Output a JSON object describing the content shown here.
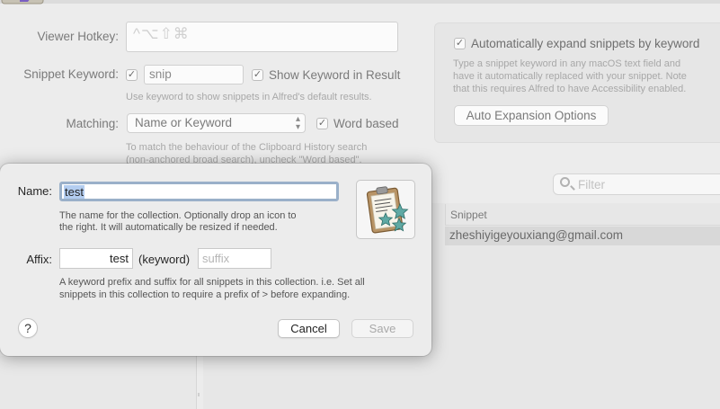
{
  "settings": {
    "viewer_hotkey_label": "Viewer Hotkey:",
    "hotkey_glyphs": "^⌥⇧⌘",
    "snippet_keyword_label": "Snippet Keyword:",
    "snippet_keyword_value": "snip",
    "snippet_keyword_checked": "✓",
    "show_keyword_label": "Show Keyword in Result",
    "show_keyword_checked": "✓",
    "keyword_hint": "Use keyword to show snippets in Alfred's default results.",
    "matching_label": "Matching:",
    "matching_value": "Name or Keyword",
    "word_based_label": "Word based",
    "word_based_checked": "✓",
    "matching_hint_1": "To match the behaviour of the Clipboard History search",
    "matching_hint_2": "(non-anchored broad search), uncheck \"Word based\"."
  },
  "auto_expansion": {
    "checkbox_checked": "✓",
    "label": "Automatically expand snippets by keyword",
    "hint_1": "Type a snippet keyword in any macOS text field and",
    "hint_2": "have it automatically replaced with your snippet. Note",
    "hint_3": "that this requires Alfred to have Accessibility enabled.",
    "options_button": "Auto Expansion Options"
  },
  "snippet_list": {
    "filter_placeholder": "Filter",
    "column_snippet": "Snippet",
    "rows": [
      "zheshiyigeyouxiang@gmail.com"
    ]
  },
  "dialog": {
    "name_label": "Name:",
    "name_value": "test",
    "name_hint_1": "The name for the collection. Optionally drop an icon to",
    "name_hint_2": "the right. It will automatically be resized if needed.",
    "affix_label": "Affix:",
    "prefix_value": "test",
    "keyword_text": "(keyword)",
    "suffix_placeholder": "suffix",
    "affix_hint_1": "A keyword prefix and suffix for all snippets in this collection. i.e. Set all",
    "affix_hint_2": "snippets in this collection to require a prefix of > before expanding.",
    "help_label": "?",
    "cancel_label": "Cancel",
    "save_label": "Save",
    "icon": "clipboard-stars-icon"
  },
  "colors": {
    "sheet_bg": "#ececec",
    "focus_ring": "#9ab0c9",
    "selection": "#b3cdf0",
    "icon_star": "#5fa9a4"
  }
}
